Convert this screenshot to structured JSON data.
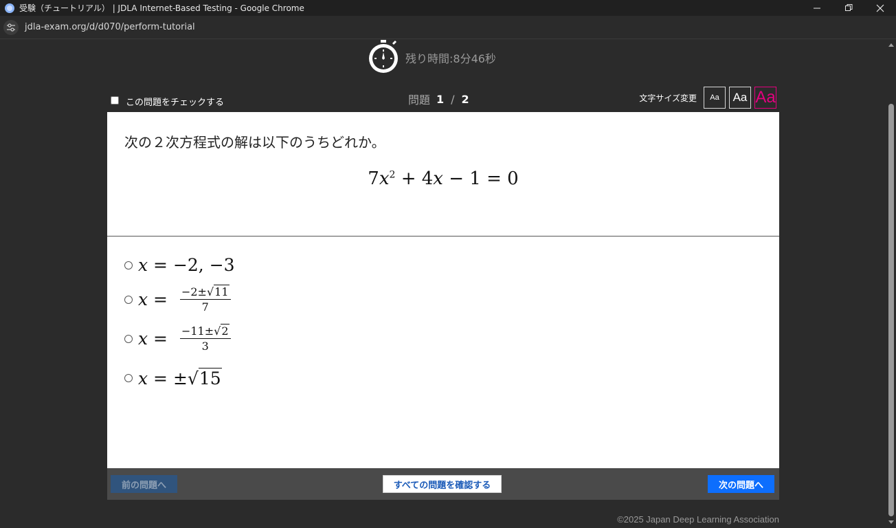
{
  "window": {
    "title": "受験（チュートリアル） | JDLA Internet-Based Testing - Google Chrome",
    "minimize_icon": "minimize-icon",
    "restore_icon": "restore-icon",
    "close_icon": "close-icon"
  },
  "address_bar": {
    "url": "jdla-exam.org/d/d070/perform-tutorial"
  },
  "timer": {
    "icon": "stopwatch-icon",
    "remaining": "残り時間:8分46秒"
  },
  "toolbar": {
    "check_label": "この問題をチェックする",
    "counter_label": "問題",
    "current": "1",
    "separator": "/",
    "total": "2",
    "font_size_label": "文字サイズ変更",
    "font_small": "Aa",
    "font_medium": "Aa",
    "font_large": "Aa",
    "active_color": "#e4007f"
  },
  "question": {
    "text": "次の２次方程式の解は以下のうちどれか。",
    "equation": {
      "coef": "7",
      "var": "x",
      "power": "2",
      "rest": " + 4",
      "var2": "x",
      "tail": " − 1 = 0"
    }
  },
  "choices": [
    {
      "var": "x",
      "eq": " = ",
      "expr": "−2, −3"
    },
    {
      "var": "x",
      "eq": " = ",
      "num_pre": "−2±",
      "num_sqrt": "11",
      "den": "7"
    },
    {
      "var": "x",
      "eq": " = ",
      "num_pre": "−11±",
      "num_sqrt": "2",
      "den": "3"
    },
    {
      "var": "x",
      "eq": " = ",
      "pm": "±",
      "sqrt": "15"
    }
  ],
  "footer": {
    "prev_label": "前の問題へ",
    "review_label": "すべての問題を確認する",
    "next_label": "次の問題へ",
    "next_color": "#0d6efd"
  },
  "copyright": "©2025 Japan Deep Learning Association"
}
